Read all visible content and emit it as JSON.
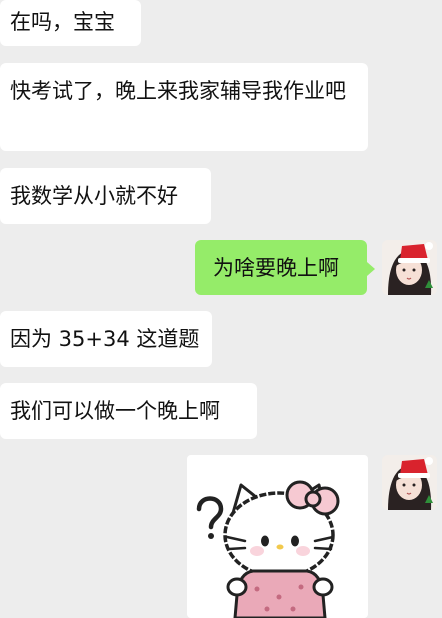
{
  "messages": [
    {
      "side": "left",
      "text": "在吗，宝宝"
    },
    {
      "side": "left",
      "text": "快考试了，晚上来我家辅导我作业吧"
    },
    {
      "side": "left",
      "text": "我数学从小就不好"
    },
    {
      "side": "right",
      "text": "为啥要晚上啊"
    },
    {
      "side": "left",
      "text": "因为 35+34 这道题"
    },
    {
      "side": "left",
      "text": "我们可以做一个晚上啊"
    },
    {
      "side": "right",
      "type": "sticker",
      "sticker": "hello-kitty-question-sticker"
    }
  ],
  "colors": {
    "background": "#ededed",
    "bubble_other": "#ffffff",
    "bubble_self": "#95ec69"
  }
}
